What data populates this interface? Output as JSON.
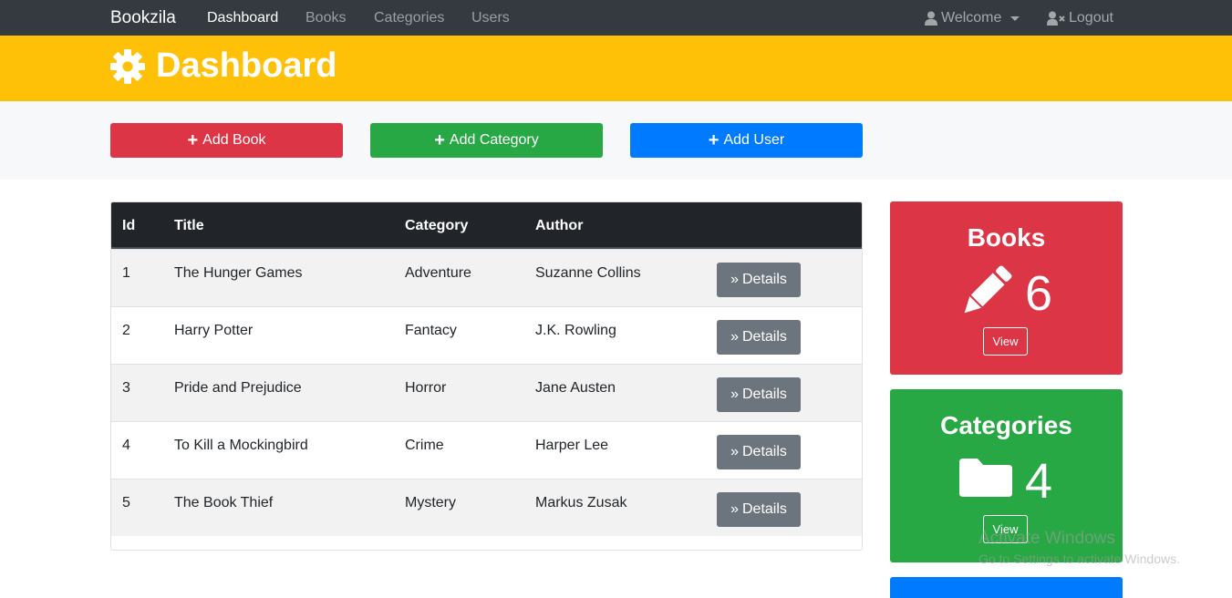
{
  "navbar": {
    "brand": "Bookzila",
    "links": [
      "Dashboard",
      "Books",
      "Categories",
      "Users"
    ],
    "welcome": "Welcome",
    "logout": "Logout"
  },
  "header": {
    "title": "Dashboard",
    "icon": "gear-icon",
    "color": "#ffc107"
  },
  "actions": {
    "add_book": "Add Book",
    "add_category": "Add Category",
    "add_user": "Add User"
  },
  "table": {
    "columns": [
      "Id",
      "Title",
      "Category",
      "Author"
    ],
    "details_label": "Details",
    "rows": [
      {
        "id": "1",
        "title": "The Hunger Games",
        "category": "Adventure",
        "author": "Suzanne Collins"
      },
      {
        "id": "2",
        "title": "Harry Potter",
        "category": "Fantacy",
        "author": "J.K. Rowling"
      },
      {
        "id": "3",
        "title": "Pride and Prejudice",
        "category": "Horror",
        "author": "Jane Austen"
      },
      {
        "id": "4",
        "title": "To Kill a Mockingbird",
        "category": "Crime",
        "author": "Harper Lee"
      },
      {
        "id": "5",
        "title": "The Book Thief",
        "category": "Mystery",
        "author": "Markus Zusak"
      }
    ]
  },
  "stats": {
    "books": {
      "title": "Books",
      "count": "6",
      "view": "View",
      "icon": "pencil-icon",
      "color": "#dc3545"
    },
    "categories": {
      "title": "Categories",
      "count": "4",
      "view": "View",
      "icon": "folder-icon",
      "color": "#28a745"
    },
    "users": {
      "color": "#007bff"
    }
  },
  "watermark": {
    "line1": "Activate Windows",
    "line2": "Go to Settings to activate Windows."
  }
}
